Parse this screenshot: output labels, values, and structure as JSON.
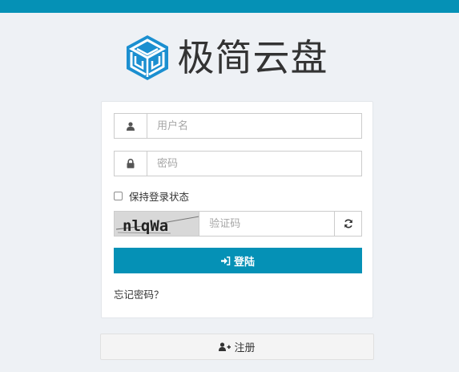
{
  "brand": {
    "name": "极简云盘",
    "logo_icon": "cube-maze-logo",
    "accent_color": "#0591b6"
  },
  "login": {
    "username_placeholder": "用户名",
    "password_placeholder": "密码",
    "remember_label": "保持登录状态",
    "remember_checked": false,
    "captcha_text": "nlqWa",
    "captcha_placeholder": "验证码",
    "login_label": "登陆",
    "forgot_label": "忘记密码？"
  },
  "register": {
    "label": "注册"
  },
  "icons": {
    "username": "user-icon",
    "password": "lock-icon",
    "refresh": "refresh-icon",
    "login": "sign-in-icon",
    "register": "user-plus-icon"
  }
}
